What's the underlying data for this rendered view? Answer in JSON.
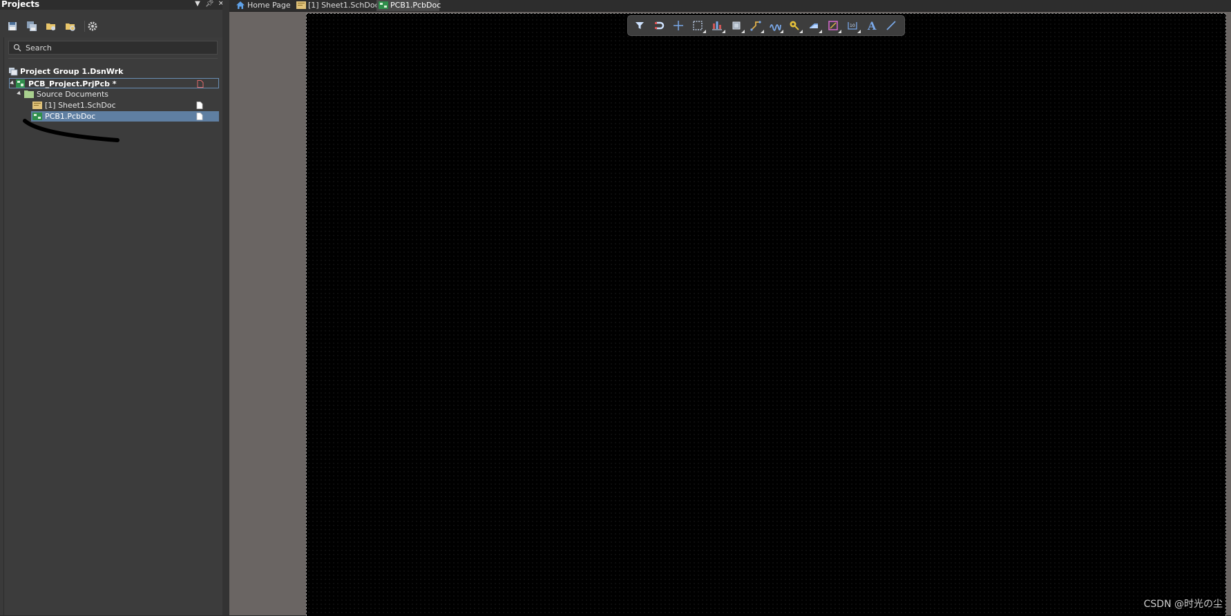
{
  "panel": {
    "title": "Projects",
    "header_buttons": [
      "dropdown-icon",
      "pin-icon",
      "close-icon"
    ],
    "toolbar": [
      "save-icon",
      "save-all-icon",
      "open-folder-icon",
      "folder-refresh-icon",
      "settings-icon"
    ],
    "search": {
      "placeholder": "Search",
      "value": ""
    },
    "tree": {
      "group": "Project Group 1.DsnWrk",
      "project": "PCB_Project.PrjPcb *",
      "folder": "Source Documents",
      "documents": [
        "[1] Sheet1.SchDoc",
        "PCB1.PcbDoc"
      ]
    }
  },
  "tabs": [
    {
      "label": "Home Page",
      "icon": "home-icon"
    },
    {
      "label": "[1] Sheet1.SchDoc",
      "icon": "schematic-icon"
    },
    {
      "label": "PCB1.PcbDoc",
      "icon": "pcb-icon",
      "active": true
    }
  ],
  "active_bar": {
    "tools": [
      "filter-icon",
      "snap-magnet-icon",
      "cross-cursor-icon",
      "select-area-icon",
      "align-icon",
      "component-icon",
      "route-icon",
      "interactive-length-icon",
      "via-icon",
      "fill-icon",
      "region-icon",
      "dimension-icon",
      "text-icon",
      "line-icon"
    ]
  },
  "watermark": "CSDN @时光の尘",
  "colors": {
    "selection": "#5f7fa2",
    "canvas": "#000000",
    "sheet": "#6a6563"
  }
}
